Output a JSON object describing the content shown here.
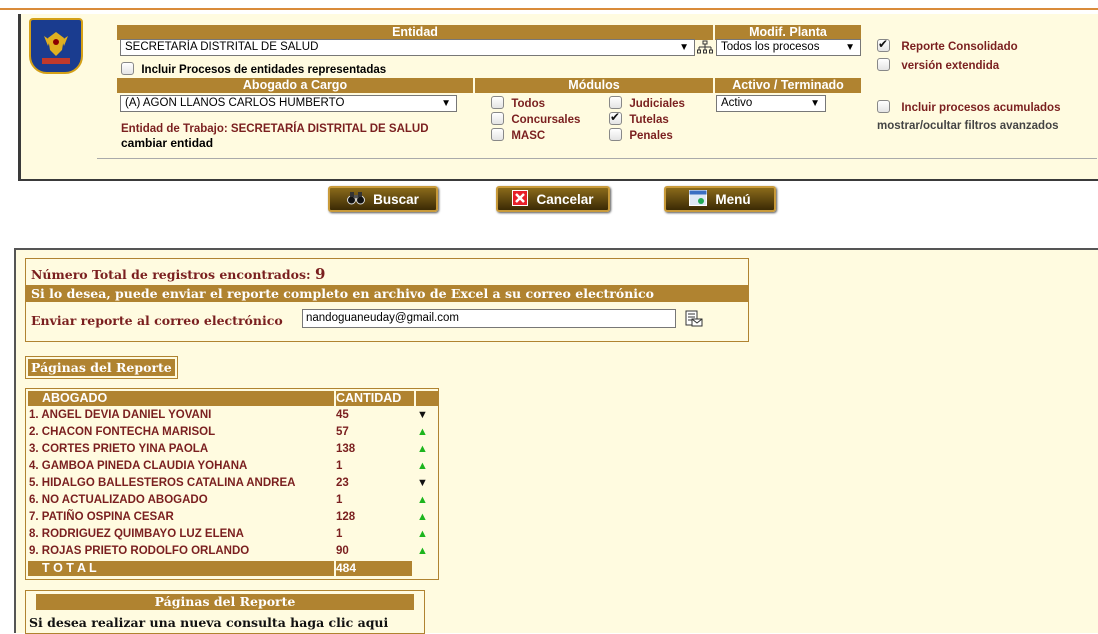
{
  "filters": {
    "entidad_label": "Entidad",
    "entidad_value": "SECRETARÍA DISTRITAL DE SALUD",
    "modif_planta_label": "Modif. Planta",
    "modif_planta_value": "Todos los procesos",
    "incluir_representadas": "Incluir Procesos de entidades representadas",
    "abogado_label": "Abogado a Cargo",
    "abogado_value": "(A) AGON LLANOS CARLOS HUMBERTO",
    "entidad_trabajo": "Entidad de Trabajo: SECRETARÍA DISTRITAL DE SALUD",
    "cambiar_entidad": "cambiar entidad",
    "modulos_label": "Módulos",
    "modulos": {
      "todos": "Todos",
      "judiciales": "Judiciales",
      "concursales": "Concursales",
      "tutelas": "Tutelas",
      "masc": "MASC",
      "penales": "Penales"
    },
    "activo_label": "Activo / Terminado",
    "activo_value": "Activo",
    "reporte_consolidado": "Reporte Consolidado",
    "version_extendida": "versión extendida",
    "incluir_acumulados": "Incluir procesos acumulados",
    "mostrar_filtros": "mostrar/ocultar filtros avanzados"
  },
  "buttons": {
    "buscar": "Buscar",
    "cancelar": "Cancelar",
    "menu": "Menú"
  },
  "results": {
    "total_label": "Número Total de registros encontrados:",
    "total_value": "9",
    "excel_msg": "Si lo desea, puede enviar el reporte completo en archivo de Excel a su correo electrónico",
    "email_label": "Enviar reporte al correo electrónico",
    "email_value": "nandoguaneuday@gmail.com",
    "paginas_label": "Páginas del Reporte",
    "table": {
      "col_abogado": "ABOGADO",
      "col_cantidad": "CANTIDAD",
      "rows": [
        {
          "name": "1. ANGEL DEVIA DANIEL YOVANI",
          "qty": "45",
          "trend": "down"
        },
        {
          "name": "2. CHACON FONTECHA MARISOL",
          "qty": "57",
          "trend": "up"
        },
        {
          "name": "3. CORTES PRIETO YINA PAOLA",
          "qty": "138",
          "trend": "up"
        },
        {
          "name": "4. GAMBOA PINEDA CLAUDIA YOHANA",
          "qty": "1",
          "trend": "up"
        },
        {
          "name": "5. HIDALGO BALLESTEROS CATALINA ANDREA",
          "qty": "23",
          "trend": "down"
        },
        {
          "name": "6. NO ACTUALIZADO ABOGADO",
          "qty": "1",
          "trend": "up"
        },
        {
          "name": "7. PATIÑO OSPINA CESAR",
          "qty": "128",
          "trend": "up"
        },
        {
          "name": "8. RODRIGUEZ QUIMBAYO LUZ ELENA",
          "qty": "1",
          "trend": "up"
        },
        {
          "name": "9. ROJAS PRIETO RODOLFO ORLANDO",
          "qty": "90",
          "trend": "up"
        }
      ],
      "total_label": "T O T A L",
      "total_value": "484"
    },
    "paginas_footer": "Páginas del Reporte",
    "nueva_consulta": "Si desea realizar una nueva consulta haga clic aqui"
  }
}
